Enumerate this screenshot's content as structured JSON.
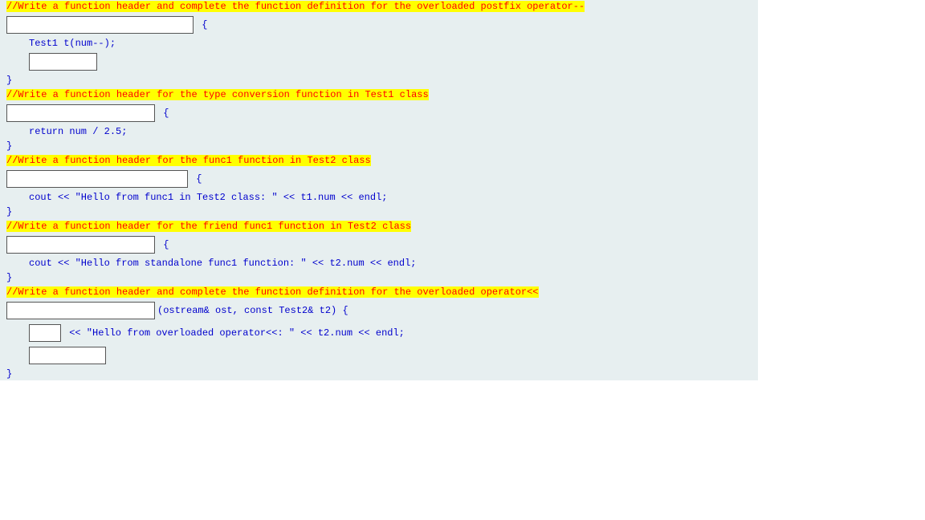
{
  "block1": {
    "comment": "//Write a function header and complete the function definition for the overloaded postfix operator--",
    "openBrace": " {",
    "body": "Test1 t(num--);",
    "closeBrace": "}"
  },
  "block2": {
    "comment": "//Write a function header for the type conversion function in Test1 class",
    "openBrace": " {",
    "body": "return num / 2.5;",
    "closeBrace": "}"
  },
  "block3": {
    "comment": "//Write a function header for the func1 function in Test2 class",
    "openBrace": " {",
    "body": "cout << \"Hello from func1 in Test2 class: \" << t1.num << endl;",
    "closeBrace": "}"
  },
  "block4": {
    "comment": "//Write a function header for the friend func1 function in Test2 class",
    "openBrace": " {",
    "body": "cout << \"Hello from standalone func1 function: \" << t2.num << endl;",
    "closeBrace": "}"
  },
  "block5": {
    "comment": "//Write a function header and complete the function definition for the overloaded operator<<",
    "sig": "(ostream& ost, const Test2& t2) {",
    "body": " << \"Hello from overloaded operator<<: \" << t2.num << endl;",
    "closeBrace": "}"
  }
}
